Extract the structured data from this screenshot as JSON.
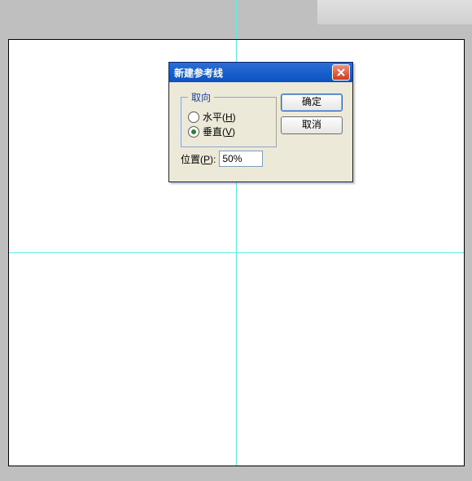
{
  "dialog": {
    "title": "新建参考线",
    "orientation": {
      "legend": "取向",
      "horizontal": {
        "label_pre": "水平(",
        "hotkey": "H",
        "label_post": ")",
        "selected": false
      },
      "vertical": {
        "label_pre": "垂直(",
        "hotkey": "V",
        "label_post": ")",
        "selected": true
      }
    },
    "position": {
      "label_pre": "位置(",
      "hotkey": "P",
      "label_post": "):",
      "value": "50%"
    },
    "ok_label": "确定",
    "cancel_label": "取消"
  },
  "guides": {
    "vertical_pct": 50,
    "horizontal_pct": 50
  }
}
